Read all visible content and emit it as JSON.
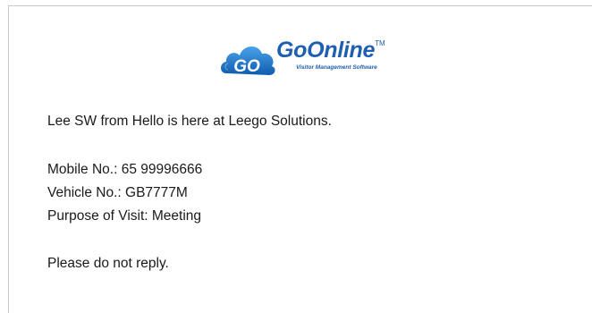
{
  "logo": {
    "badge_text": "GO",
    "brand_prefix": "Go",
    "brand_suffix": "Online",
    "trademark": "TM",
    "tagline": "Visitor Management Software"
  },
  "message": {
    "arrival": "Lee SW from Hello is here at Leego Solutions.",
    "mobile": "Mobile No.: 65 99996666",
    "vehicle": "Vehicle No.: GB7777M",
    "purpose": "Purpose of Visit: Meeting",
    "footer": "Please do not reply."
  },
  "colors": {
    "brand_blue": "#1f5fb0",
    "badge_blue": "#1a6fc9",
    "text": "#1a1a1a"
  }
}
